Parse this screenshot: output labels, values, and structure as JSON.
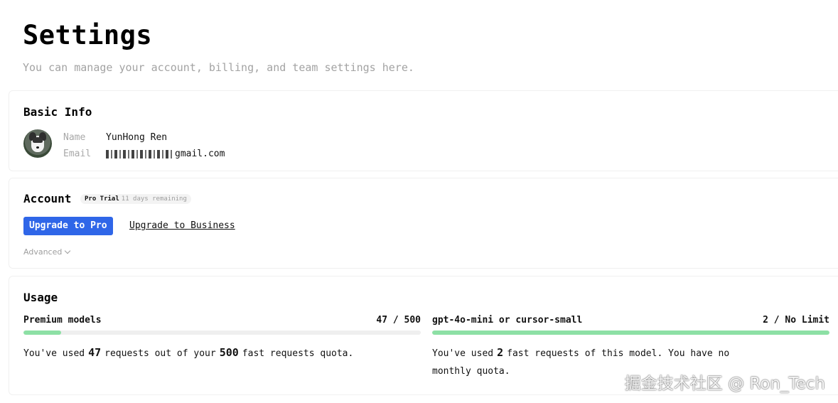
{
  "header": {
    "title": "Settings",
    "subtitle": "You can manage your account, billing, and team settings here."
  },
  "basic_info": {
    "title": "Basic Info",
    "name_label": "Name",
    "name_value": "YunHong Ren",
    "email_label": "Email",
    "email_visible_suffix": "gmail.com"
  },
  "account": {
    "title": "Account",
    "plan_badge": "Pro Trial",
    "trial_remaining": "11 days remaining",
    "upgrade_pro_label": "Upgrade to Pro",
    "upgrade_business_label": "Upgrade to Business",
    "advanced_label": "Advanced",
    "accent_color": "#2f66e8"
  },
  "usage": {
    "title": "Usage",
    "premium": {
      "name": "Premium models",
      "ratio": "47 / 500",
      "used": 47,
      "quota": 500,
      "fill_fraction": 0.094,
      "text_prefix": "You've used",
      "used_text": "47",
      "text_middle": "requests out of your",
      "quota_text": "500",
      "text_suffix": "fast requests quota."
    },
    "mini": {
      "name": "gpt-4o-mini or cursor-small",
      "ratio": "2 / No Limit",
      "fill_fraction": 1.0,
      "text_prefix": "You've used",
      "used_text": "2",
      "text_suffix": "fast requests of this model. You have no monthly quota."
    },
    "bar_color": "#8de0a5"
  },
  "watermark": "掘金技术社区 @ Ron_Tech"
}
